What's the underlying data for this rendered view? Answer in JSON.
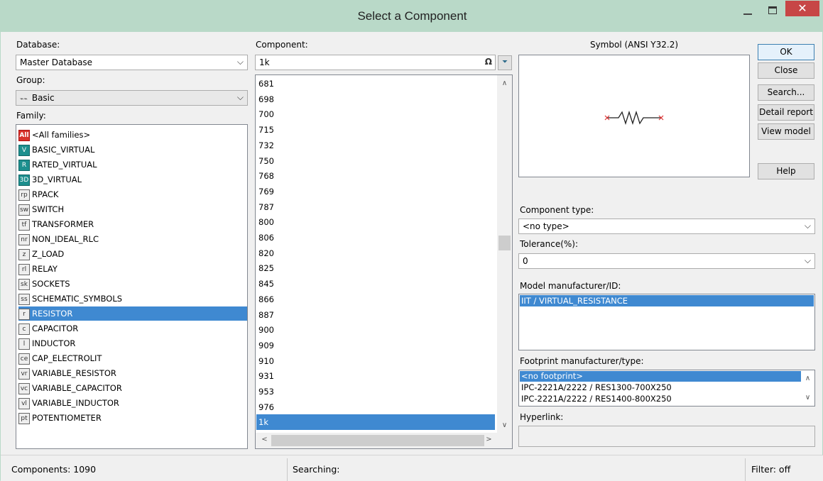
{
  "window": {
    "title": "Select a Component"
  },
  "database": {
    "label": "Database:",
    "value": "Master Database"
  },
  "group": {
    "label": "Group:",
    "value": "Basic",
    "icon": "resistor-symbol-icon"
  },
  "family": {
    "label": "Family:",
    "items": [
      {
        "label": "<All families>",
        "icon": "All"
      },
      {
        "label": "BASIC_VIRTUAL",
        "icon": "V"
      },
      {
        "label": "RATED_VIRTUAL",
        "icon": "R"
      },
      {
        "label": "3D_VIRTUAL",
        "icon": "3D"
      },
      {
        "label": "RPACK",
        "icon": "rp"
      },
      {
        "label": "SWITCH",
        "icon": "sw"
      },
      {
        "label": "TRANSFORMER",
        "icon": "tf"
      },
      {
        "label": "NON_IDEAL_RLC",
        "icon": "nr"
      },
      {
        "label": "Z_LOAD",
        "icon": "z"
      },
      {
        "label": "RELAY",
        "icon": "rl"
      },
      {
        "label": "SOCKETS",
        "icon": "sk"
      },
      {
        "label": "SCHEMATIC_SYMBOLS",
        "icon": "ss"
      },
      {
        "label": "RESISTOR",
        "icon": "r"
      },
      {
        "label": "CAPACITOR",
        "icon": "c"
      },
      {
        "label": "INDUCTOR",
        "icon": "l"
      },
      {
        "label": "CAP_ELECTROLIT",
        "icon": "ce"
      },
      {
        "label": "VARIABLE_RESISTOR",
        "icon": "vr"
      },
      {
        "label": "VARIABLE_CAPACITOR",
        "icon": "vc"
      },
      {
        "label": "VARIABLE_INDUCTOR",
        "icon": "vl"
      },
      {
        "label": "POTENTIOMETER",
        "icon": "pt"
      }
    ],
    "selected": "RESISTOR"
  },
  "component": {
    "label": "Component:",
    "search_value": "1k",
    "items": [
      "681",
      "698",
      "700",
      "715",
      "732",
      "750",
      "768",
      "769",
      "787",
      "800",
      "806",
      "820",
      "825",
      "845",
      "866",
      "887",
      "900",
      "909",
      "910",
      "931",
      "953",
      "976",
      "1k"
    ],
    "selected": "1k"
  },
  "symbol": {
    "label": "Symbol (ANSI Y32.2)"
  },
  "buttons": {
    "ok": "OK",
    "close": "Close",
    "search": "Search...",
    "detail_report": "Detail report",
    "view_model": "View model",
    "help": "Help"
  },
  "component_type": {
    "label": "Component type:",
    "value": "<no type>"
  },
  "tolerance": {
    "label": "Tolerance(%):",
    "value": "0"
  },
  "model_manufacturer": {
    "label": "Model manufacturer/ID:",
    "items": [
      "IIT / VIRTUAL_RESISTANCE"
    ]
  },
  "footprint": {
    "label": "Footprint manufacturer/type:",
    "items": [
      "<no footprint>",
      "IPC-2221A/2222 / RES1300-700X250",
      "IPC-2221A/2222 / RES1400-800X250"
    ]
  },
  "hyperlink": {
    "label": "Hyperlink:",
    "value": ""
  },
  "status": {
    "components": "Components: 1090",
    "searching": "Searching:",
    "filter": "Filter: off"
  },
  "colors": {
    "selection": "#3f89d1",
    "titlebar": "#b9d9c8",
    "close_button": "#c74646"
  }
}
